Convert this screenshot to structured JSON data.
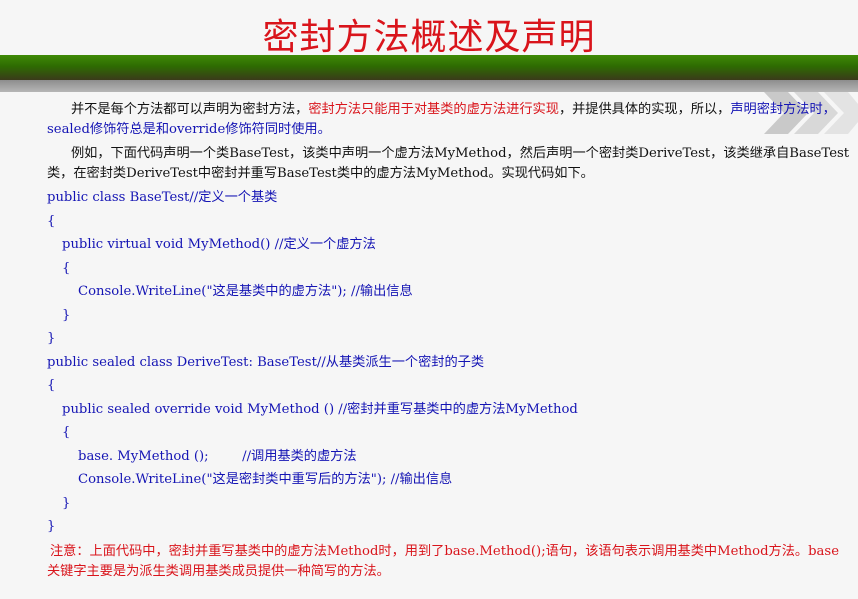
{
  "slide": {
    "title": "密封方法概述及声明",
    "paragraph1": {
      "part1": "并不是每个方法都可以声明为密封方法，",
      "part2": "密封方法只能用于对基类的虚方法进行实现",
      "part3": "，并提供具体的实现，所以，",
      "part4": "声明密封方法时，sealed修饰符总是和override修饰符同时使用。"
    },
    "paragraph2": "例如，下面代码声明一个类BaseTest，该类中声明一个虚方法MyMethod，然后声明一个密封类DeriveTest，该类继承自BaseTest类，在密封类DeriveTest中密封并重写BaseTest类中的虚方法MyMethod。实现代码如下。",
    "code": [
      "public class BaseTest//定义一个基类",
      "{",
      "public virtual void MyMethod() //定义一个虚方法",
      "{",
      "Console.WriteLine(\"这是基类中的虚方法\"); //输出信息",
      "}",
      "}",
      "public sealed class DeriveTest: BaseTest//从基类派生一个密封的子类",
      "{",
      "public sealed override void MyMethod () //密封并重写基类中的虚方法MyMethod",
      "{",
      "base. MyMethod ();        //调用基类的虚方法",
      "Console.WriteLine(\"这是密封类中重写后的方法\"); //输出信息",
      "}",
      "}"
    ],
    "note": "注意：上面代码中，密封并重写基类中的虚方法Method时，用到了base.Method();语句，该语句表示调用基类中Method方法。base关键字主要是为派生类调用基类成员提供一种简写的方法。"
  },
  "colors": {
    "title": "#d9141b",
    "code": "#1414b4",
    "body": "#111111",
    "highlight": "#d9141b",
    "band": "#3f8a06"
  }
}
